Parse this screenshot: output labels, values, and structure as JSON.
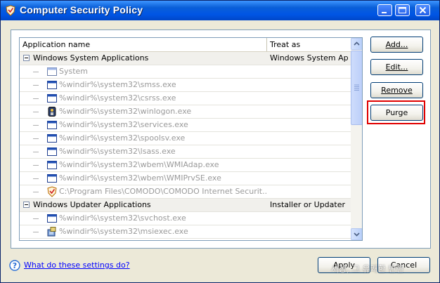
{
  "window": {
    "title": "Computer Security Policy"
  },
  "table": {
    "headers": {
      "name": "Application name",
      "treat": "Treat as"
    },
    "rows": [
      {
        "type": "group",
        "name": "Windows System Applications",
        "treat": "Windows System Ap..."
      },
      {
        "type": "child",
        "icon": "system-window-icon",
        "name": "System",
        "treat": ""
      },
      {
        "type": "child",
        "icon": "app-window-icon",
        "name": "%windir%\\system32\\smss.exe",
        "treat": ""
      },
      {
        "type": "child",
        "icon": "app-window-icon",
        "name": "%windir%\\system32\\csrss.exe",
        "treat": ""
      },
      {
        "type": "child",
        "icon": "winlogon-icon",
        "name": "%windir%\\system32\\winlogon.exe",
        "treat": ""
      },
      {
        "type": "child",
        "icon": "app-window-icon",
        "name": "%windir%\\system32\\services.exe",
        "treat": ""
      },
      {
        "type": "child",
        "icon": "app-window-icon",
        "name": "%windir%\\system32\\spoolsv.exe",
        "treat": ""
      },
      {
        "type": "child",
        "icon": "app-window-icon",
        "name": "%windir%\\system32\\lsass.exe",
        "treat": ""
      },
      {
        "type": "child",
        "icon": "app-window-icon",
        "name": "%windir%\\system32\\wbem\\WMIAdap.exe",
        "treat": ""
      },
      {
        "type": "child",
        "icon": "app-window-icon",
        "name": "%windir%\\system32\\wbem\\WMIPrvSE.exe",
        "treat": ""
      },
      {
        "type": "child",
        "icon": "comodo-shield-icon",
        "name": "C:\\Program Files\\COMODO\\COMODO Internet Securit...",
        "treat": ""
      },
      {
        "type": "group",
        "name": "Windows Updater Applications",
        "treat": "Installer or Updater"
      },
      {
        "type": "child",
        "icon": "app-window-icon",
        "name": "%windir%\\system32\\svchost.exe",
        "treat": ""
      },
      {
        "type": "child",
        "icon": "installer-icon",
        "name": "%windir%\\system32\\msiexec.exe",
        "treat": ""
      }
    ]
  },
  "buttons": {
    "add": "Add...",
    "edit": "Edit...",
    "remove": "Remove",
    "purge": "Purge",
    "apply": "Apply",
    "cancel": "Cancel"
  },
  "help": {
    "link": "What do these settings do?"
  },
  "watermark": "세상, 그 유쾌한 반란",
  "colors": {
    "title_bar": "#0055e5",
    "highlight_box": "#e00000",
    "link": "#0000ff"
  }
}
